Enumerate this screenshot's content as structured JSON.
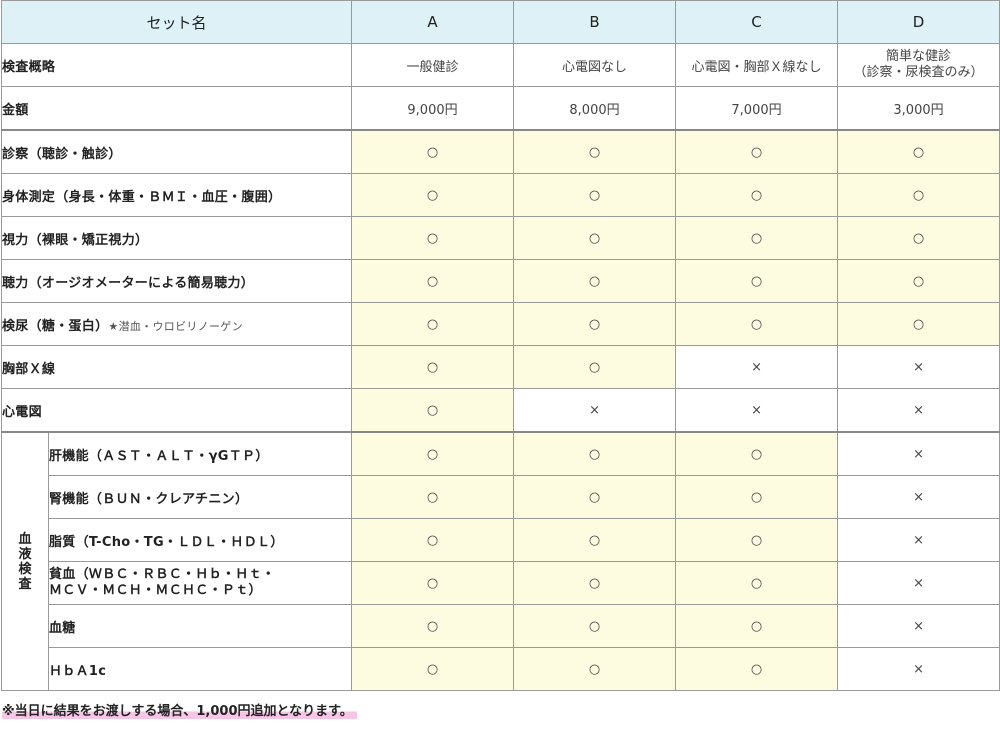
{
  "header": {
    "name": "セット名",
    "a": "A",
    "b": "B",
    "c": "C",
    "d": "D"
  },
  "summary": {
    "label": "検査概略",
    "a": "一般健診",
    "b": "心電図なし",
    "c": "心電図・胸部Ｘ線なし",
    "d_line1": "簡単な健診",
    "d_line2": "（診察・尿検査のみ）"
  },
  "price": {
    "label": "金額",
    "a": "9,000円",
    "b": "8,000円",
    "c": "7,000円",
    "d": "3,000円"
  },
  "rows": [
    {
      "label": "診察（聴診・触診）",
      "a": "○",
      "b": "○",
      "c": "○",
      "d": "○"
    },
    {
      "label": "身体測定（身長・体重・ＢＭＩ・血圧・腹囲）",
      "a": "○",
      "b": "○",
      "c": "○",
      "d": "○"
    },
    {
      "label": "視力（裸眼・矯正視力）",
      "a": "○",
      "b": "○",
      "c": "○",
      "d": "○"
    },
    {
      "label": "聴力（オージオメーターによる簡易聴力）",
      "a": "○",
      "b": "○",
      "c": "○",
      "d": "○"
    },
    {
      "label": "検尿（糖・蛋白）",
      "sub": "★潜血・ウロビリノーゲン",
      "a": "○",
      "b": "○",
      "c": "○",
      "d": "○"
    },
    {
      "label": "胸部Ｘ線",
      "a": "○",
      "b": "○",
      "c": "×",
      "d": "×"
    },
    {
      "label": "心電図",
      "a": "○",
      "b": "×",
      "c": "×",
      "d": "×"
    }
  ],
  "blood": {
    "group_label": "血液検査",
    "rows": [
      {
        "label": "肝機能（ＡＳＴ・ＡＬＴ・γGＴＰ）",
        "a": "○",
        "b": "○",
        "c": "○",
        "d": "×"
      },
      {
        "label": "腎機能（ＢＵＮ・クレアチニン）",
        "a": "○",
        "b": "○",
        "c": "○",
        "d": "×"
      },
      {
        "label": "脂質（T-Cho・TG・ＬＤＬ・ＨＤＬ）",
        "a": "○",
        "b": "○",
        "c": "○",
        "d": "×"
      },
      {
        "label_line1": "貧血（ＷＢＣ・ＲＢＣ・Ｈｂ・Ｈｔ・",
        "label_line2": "ＭＣＶ・ＭＣＨ・ＭＣＨＣ・Ｐｔ）",
        "a": "○",
        "b": "○",
        "c": "○",
        "d": "×"
      },
      {
        "label": "血糖",
        "a": "○",
        "b": "○",
        "c": "○",
        "d": "×"
      },
      {
        "label": "ＨｂＡ1c",
        "a": "○",
        "b": "○",
        "c": "○",
        "d": "×"
      }
    ]
  },
  "footnote": "※当日に結果をお渡しする場合、1,000円追加となります。",
  "colors": {
    "header_bg": "#ddf1f7",
    "included_bg": "#fdfbe0",
    "note_highlight": "#f7c6e6"
  }
}
